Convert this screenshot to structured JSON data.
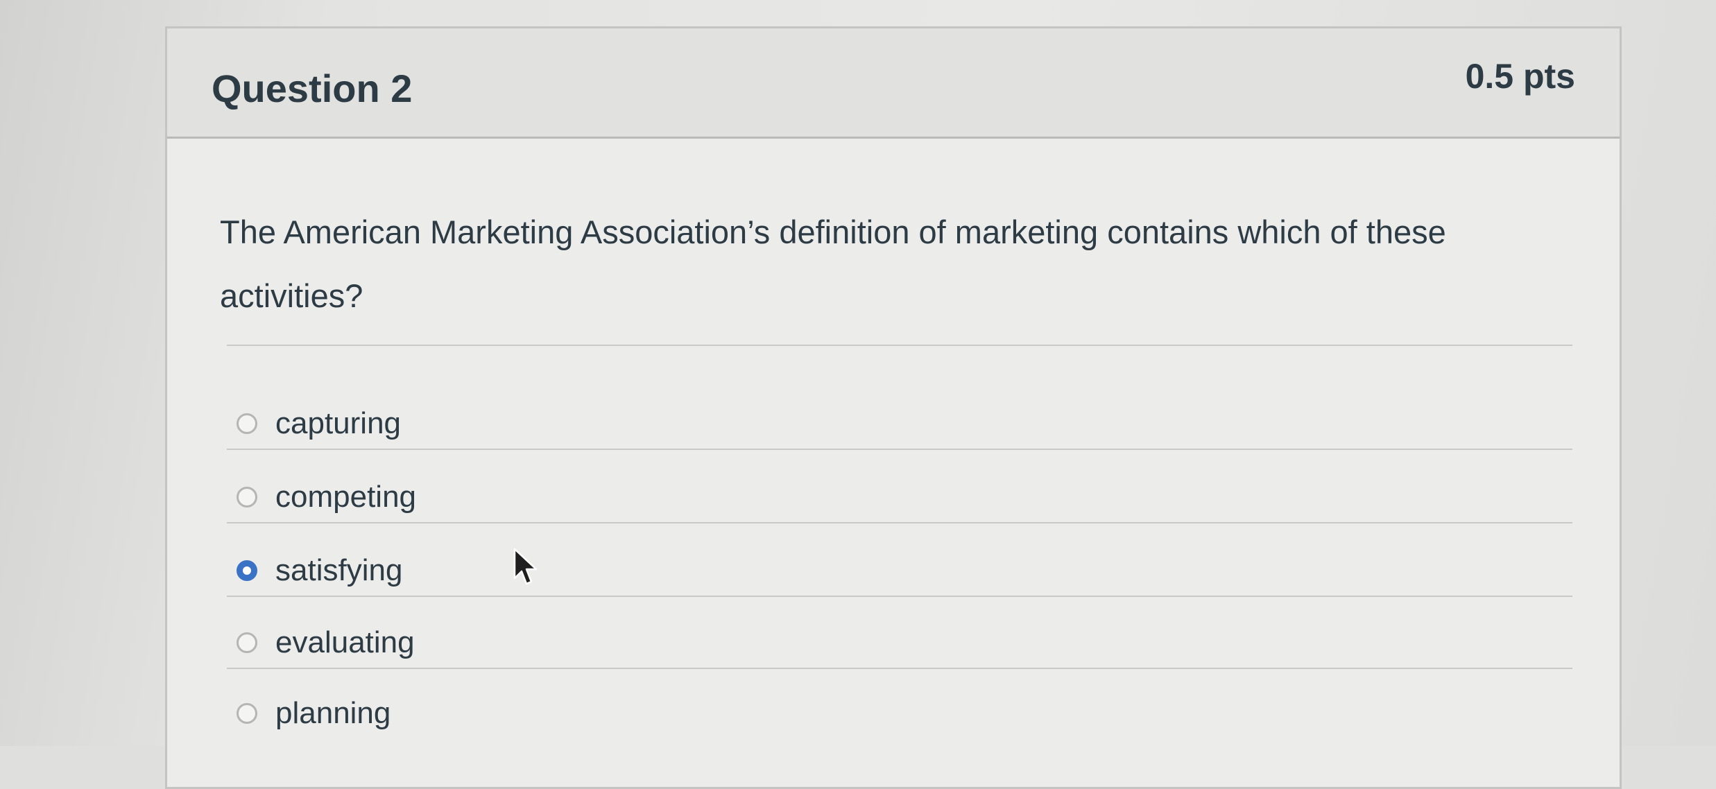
{
  "question": {
    "title": "Question 2",
    "points": "0.5 pts",
    "prompt": "The American Marketing Association’s definition of marketing contains which of these activities?"
  },
  "answers": [
    {
      "label": "capturing",
      "selected": false
    },
    {
      "label": "competing",
      "selected": false
    },
    {
      "label": "satisfying",
      "selected": true
    },
    {
      "label": "evaluating",
      "selected": false
    },
    {
      "label": "planning",
      "selected": false
    }
  ],
  "colors": {
    "selected_radio": "#3a73c6",
    "text": "#2d3b45"
  },
  "icons": {
    "cursor": "mouse-pointer-icon"
  }
}
